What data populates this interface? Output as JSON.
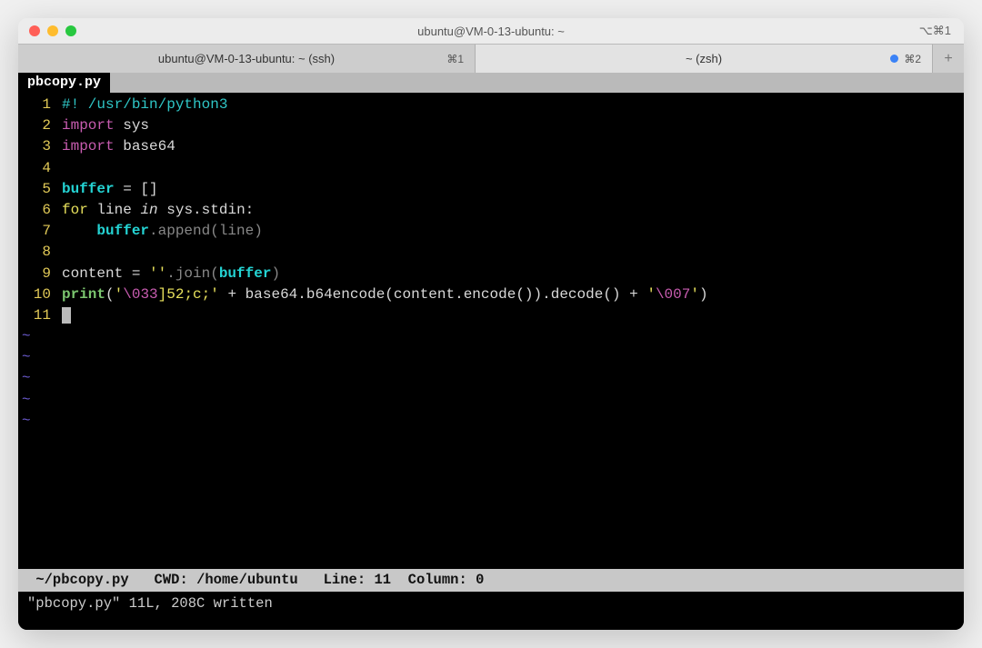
{
  "window": {
    "title": "ubuntu@VM-0-13-ubuntu: ~",
    "shortcut": "⌥⌘1"
  },
  "tabs": [
    {
      "label": "ubuntu@VM-0-13-ubuntu: ~ (ssh)",
      "shortcut": "⌘1",
      "active": false,
      "indicator": false
    },
    {
      "label": "~ (zsh)",
      "shortcut": "⌘2",
      "active": true,
      "indicator": true
    }
  ],
  "buffer_tab": "pbcopy.py",
  "code": {
    "l1": {
      "cmt": "#! /usr/bin/python3"
    },
    "l2": {
      "imp": "import",
      "mod": "sys"
    },
    "l3": {
      "imp": "import",
      "mod": "base64"
    },
    "l5": {
      "var": "buffer",
      "rest": " = []"
    },
    "l6": {
      "for": "for",
      "line": "line",
      "in": "in",
      "iter": "sys.stdin:"
    },
    "l7": {
      "indent": "    ",
      "var": "buffer",
      "call": ".append(line)"
    },
    "l9": {
      "lhs": "content = ",
      "strq": "''",
      "j": ".join(",
      "arg": "buffer",
      "close": ")"
    },
    "l10": {
      "fn": "print",
      "open": "(",
      "q1": "'",
      "esc1": "\\033",
      "mid1": "]52;c;",
      "q1c": "'",
      "plus1": " + base64.b64encode(content.encode()).decode() + ",
      "q2": "'",
      "esc2": "\\007",
      "q2c": "'",
      "close": ")"
    }
  },
  "linenos": [
    "1",
    "2",
    "3",
    "4",
    "5",
    "6",
    "7",
    "8",
    "9",
    "10",
    "11"
  ],
  "status": {
    "file": "~/pbcopy.py",
    "cwd_label": "CWD:",
    "cwd": "/home/ubuntu",
    "line_label": "Line:",
    "line": "11",
    "col_label": "Column:",
    "col": "0"
  },
  "message": "\"pbcopy.py\" 11L, 208C written"
}
